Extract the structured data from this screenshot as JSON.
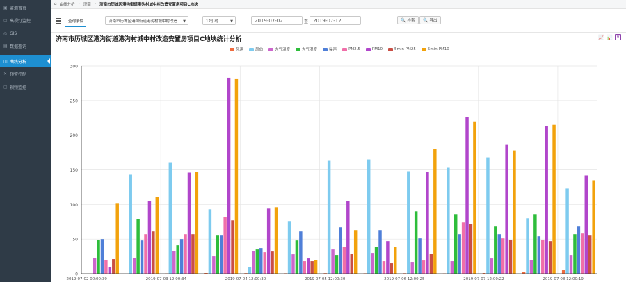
{
  "sidebar": {
    "items": [
      {
        "label": "监测首页",
        "icon": "home-icon",
        "glyph": "▣"
      },
      {
        "label": "高视灯监控",
        "icon": "video-icon",
        "glyph": "▭"
      },
      {
        "label": "GIS",
        "icon": "map-icon",
        "glyph": "◎"
      },
      {
        "label": "数据查询",
        "icon": "search-icon",
        "glyph": "▤"
      },
      {
        "label": "曲线分析",
        "icon": "chart-icon",
        "glyph": "◫"
      },
      {
        "label": "预警控制",
        "icon": "alert-icon",
        "glyph": "✕"
      },
      {
        "label": "视频监控",
        "icon": "camera-icon",
        "glyph": "▢"
      }
    ],
    "active_index": 4
  },
  "breadcrumb": {
    "home_glyph": "⌂",
    "items": [
      "曲线分析",
      "济南"
    ],
    "current": "济南市历城区港沟街道港沟村城中村改造安置房项目C地块"
  },
  "toolbar": {
    "tab_label": "查询条件",
    "site_select": "济南市历城区港沟街道港沟村城中村改造",
    "interval_select": "12小时",
    "date_from": "2019-07-02",
    "to_label": "至",
    "date_to": "2019-07-12",
    "search_label": "检索",
    "export_label": "导出",
    "arrow_glyph": "▼",
    "search_glyph": "🔍",
    "export_glyph": "🔍"
  },
  "chart_header": {
    "title": "济南市历城区港沟街道港沟村城中村改造安置房项目C地块统计分析",
    "view_line_glyph": "📈",
    "view_bar_glyph": "📊",
    "view_v_glyph": "V"
  },
  "colors": {
    "accent": "#1e8fd1",
    "sidebar_bg": "#2f3b47"
  },
  "chart_data": {
    "type": "bar",
    "title": "",
    "ylim": [
      0,
      300
    ],
    "yticks": [
      0,
      50,
      100,
      150,
      200,
      250,
      300
    ],
    "grid": true,
    "legend_position": "top",
    "xtick_labels": [
      "2019-07-02 00:00:39",
      "2019-07-03 12:00:34",
      "2019-07-04 12:00:30",
      "2019-07-05 12:00:30",
      "2019-07-06 12:00:25",
      "2019-07-07 12:00:22",
      "2019-07-08 12:00:19"
    ],
    "series": [
      {
        "name": "风速",
        "color": "#ef6b3e",
        "values": [
          0.5,
          1,
          0.8,
          0.6,
          0.8,
          0.6,
          0.7,
          0.5,
          1.0,
          3,
          5
        ]
      },
      {
        "name": "风向",
        "color": "#7ecbef",
        "values": [
          143,
          161,
          93,
          10,
          76,
          163,
          165,
          148,
          153,
          168,
          80,
          123
        ]
      },
      {
        "name": "大气温度",
        "color": "#cc66cc",
        "values": [
          23,
          23,
          33,
          25,
          33,
          28,
          35,
          30,
          17,
          18,
          22,
          20,
          27
        ]
      },
      {
        "name": "大气湿度",
        "color": "#2ebd3b",
        "values": [
          49,
          79,
          41,
          55,
          35,
          48,
          27,
          39,
          90,
          86,
          68,
          86,
          57
        ]
      },
      {
        "name": "噪声",
        "color": "#4f7fd8",
        "values": [
          50,
          48,
          50,
          55,
          37,
          61,
          67,
          63,
          51,
          57,
          57,
          54,
          68
        ]
      },
      {
        "name": "PM2.5",
        "color": "#f06fa9",
        "values": [
          20,
          57,
          57,
          82,
          31,
          18,
          39,
          18,
          19,
          74,
          51,
          49,
          58
        ]
      },
      {
        "name": "PM10",
        "color": "#b146cb",
        "values": [
          10,
          105,
          146,
          283,
          94,
          22,
          105,
          47,
          147,
          226,
          186,
          213,
          142
        ]
      },
      {
        "name": "5min-PM25",
        "color": "#c94f45",
        "values": [
          21,
          61,
          57,
          77,
          32,
          18,
          29,
          15,
          29,
          72,
          49,
          47,
          55
        ]
      },
      {
        "name": "5min-PM10",
        "color": "#f2a20c",
        "values": [
          102,
          111,
          147,
          281,
          96,
          20,
          63,
          39,
          180,
          220,
          178,
          215,
          135
        ]
      }
    ]
  }
}
